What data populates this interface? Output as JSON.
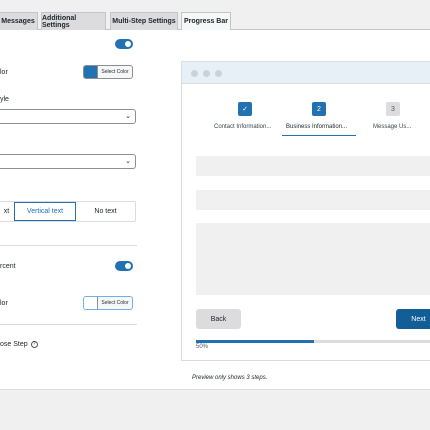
{
  "tabs": [
    {
      "label": "Messages",
      "active": false
    },
    {
      "label": "Additional Settings",
      "active": false
    },
    {
      "label": "Multi-Step Settings",
      "active": false
    },
    {
      "label": "Progress Bar",
      "active": true
    }
  ],
  "settings": {
    "color_label": "lor",
    "color_button": "Select Color",
    "color_swatch": "#2271b1",
    "style_label": "yle",
    "text_position_options": [
      "xt",
      "Vertical text",
      "No text"
    ],
    "percent_label": "rcent",
    "color2_label": "lor",
    "color2_button": "Select Color",
    "color2_swatch": "#ffffff",
    "close_step_label": "ose Step",
    "help_glyph": "?"
  },
  "preview": {
    "steps": [
      {
        "number": "✓",
        "label": "Contact Information...",
        "state": "done"
      },
      {
        "number": "2",
        "label": "Business Information...",
        "state": "current"
      },
      {
        "number": "3",
        "label": "Message Us...",
        "state": "upcoming"
      }
    ],
    "back_label": "Back",
    "next_label": "Next",
    "progress_percent": 50,
    "progress_text": "50%",
    "note": "Preview only shows 3 steps."
  }
}
